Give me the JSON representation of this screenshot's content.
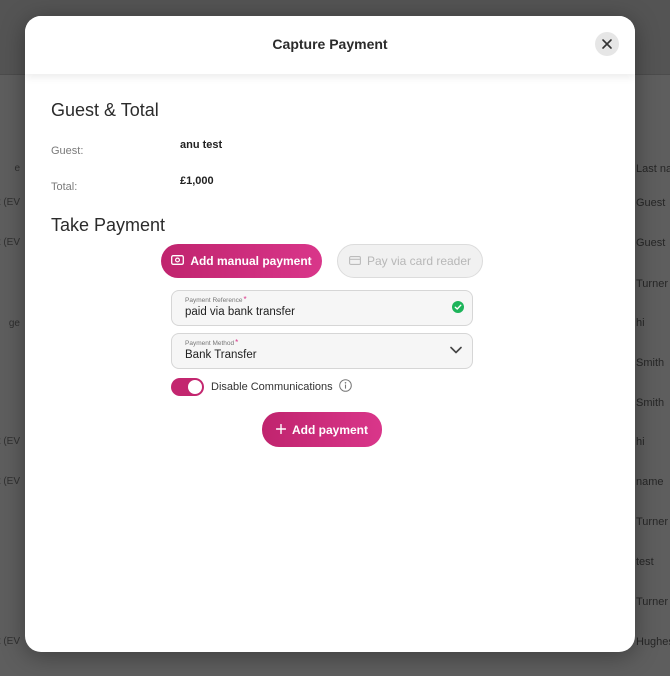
{
  "background": {
    "left_fragments": [
      "e",
      "et (EV",
      "et (EV",
      "ge",
      "et (EV",
      "et (EV",
      "et (EV"
    ],
    "right_fragments": [
      "Last na",
      "Guest",
      "Guest",
      "Turner",
      "hi",
      "Smith",
      "Smith",
      "hi",
      "name",
      "Turner",
      "test",
      "Turner",
      "Hughes"
    ]
  },
  "modal": {
    "title": "Capture Payment",
    "close_icon": "close-icon"
  },
  "guest_total": {
    "heading": "Guest & Total",
    "guest_label": "Guest:",
    "guest_value": "anu test",
    "total_label": "Total:",
    "total_value": "£1,000"
  },
  "take_payment": {
    "heading": "Take Payment",
    "manual_button": "Add manual payment",
    "card_button": "Pay via card reader",
    "reference": {
      "label": "Payment Reference",
      "required": "*",
      "value": "paid via bank transfer"
    },
    "method": {
      "label": "Payment Method",
      "required": "*",
      "value": "Bank Transfer"
    },
    "disable_comms_label": "Disable Communications",
    "disable_comms_on": true,
    "add_payment_button": "Add payment"
  },
  "colors": {
    "accent": "#c3266f",
    "success": "#1db45a"
  }
}
